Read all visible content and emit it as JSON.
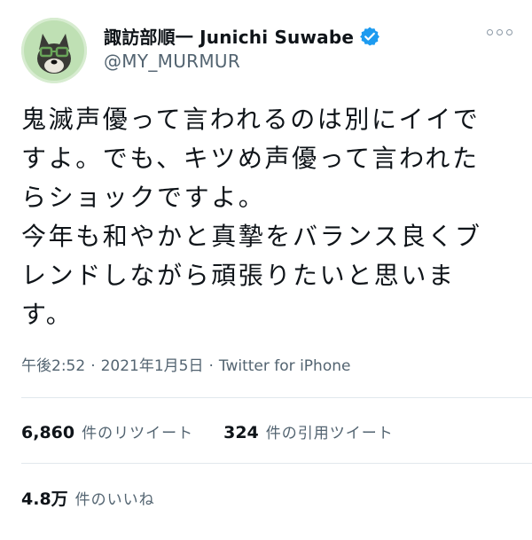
{
  "user": {
    "display_name": "諏訪部順一 Junichi Suwabe",
    "handle": "@MY_MURMUR",
    "verified": true
  },
  "tweet": {
    "lines": [
      "鬼滅声優って言われるのは別にイイで",
      "すよ。でも、キツめ声優って言われた",
      "らショックですよ。",
      "今年も和やかと真摯をバランス良くブ",
      "レンドしながら頑張りたいと思いま",
      "す。"
    ]
  },
  "meta": {
    "time": "午後2:52",
    "separator": "·",
    "date": "2021年1月5日",
    "source": "Twitter for iPhone"
  },
  "stats": {
    "retweets": {
      "count": "6,860",
      "label": "件のリツイート"
    },
    "quotes": {
      "count": "324",
      "label": "件の引用ツイート"
    },
    "likes": {
      "count": "4.8万",
      "label": "件のいいね"
    }
  },
  "colors": {
    "verified": "#1d9bf0",
    "secondary_text": "#536471",
    "divider": "#e1e8ed"
  },
  "icons": {
    "verified": "verified-badge-icon",
    "more": "more-options-icon"
  }
}
